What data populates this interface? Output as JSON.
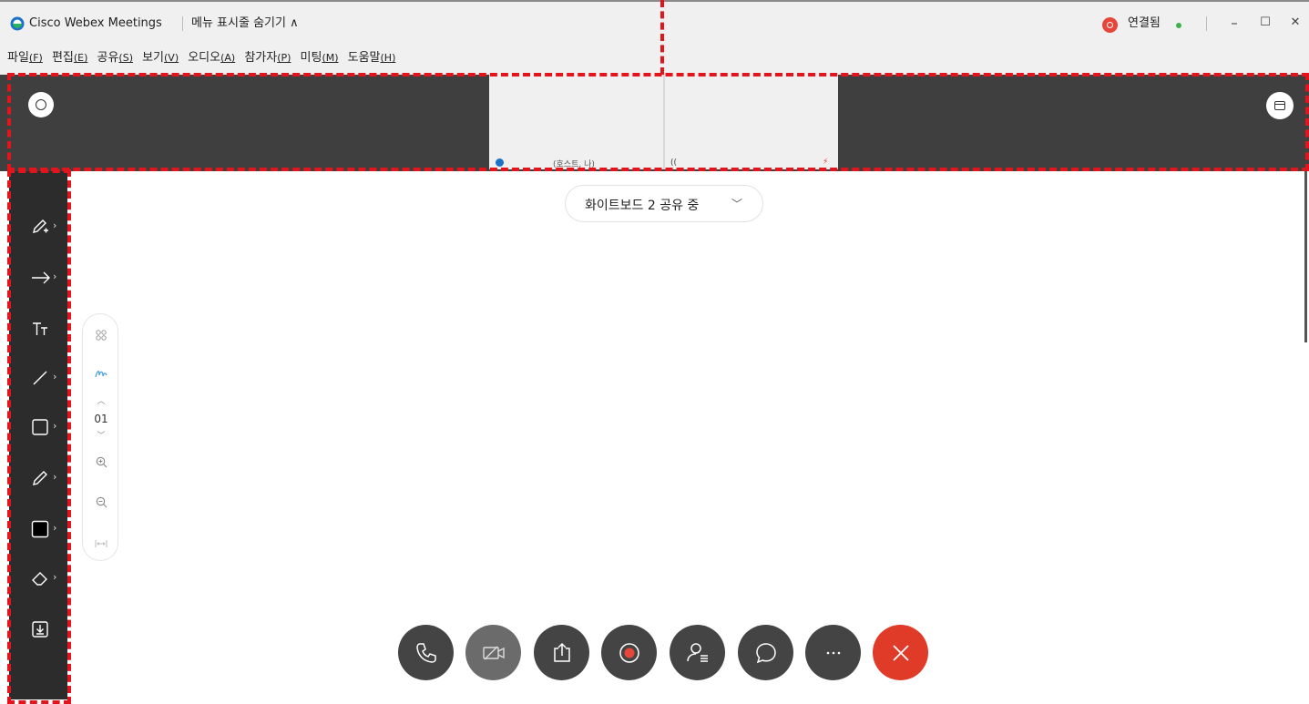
{
  "window": {
    "app_title": "Cisco Webex Meetings",
    "menu_toggle": "메뉴 표시줄 숨기기 ∧",
    "status_text": "연결됨",
    "min_glyph": "–",
    "max_glyph": "☐",
    "close_glyph": "✕"
  },
  "menu": [
    {
      "label": "파일",
      "key": "(F)"
    },
    {
      "label": "편집",
      "key": "(E)"
    },
    {
      "label": "공유",
      "key": "(S)"
    },
    {
      "label": "보기",
      "key": "(V)"
    },
    {
      "label": "오디오",
      "key": "(A)"
    },
    {
      "label": "참가자",
      "key": "(P)"
    },
    {
      "label": "미팅",
      "key": "(M)"
    },
    {
      "label": "도움말",
      "key": "(H)"
    }
  ],
  "video": {
    "host_label": "(호스트, 나)"
  },
  "share": {
    "label": "화이트보드 2 공유 중"
  },
  "zoom": {
    "page_number": "01"
  },
  "colors": {
    "accent_red": "#e4141c",
    "end_call": "#e03a28",
    "toolbar_bg": "#2c2c2c",
    "video_strip_bg": "#3f3f3f",
    "connected_green": "#3db24b"
  },
  "icons": {
    "toolbar": [
      "pen-plus-icon",
      "arrow-icon",
      "text-icon",
      "line-icon",
      "rectangle-icon",
      "pencil-icon",
      "color-swatch-icon",
      "eraser-icon",
      "save-icon"
    ],
    "controls": [
      "phone-icon",
      "video-off-icon",
      "share-icon",
      "record-icon",
      "participants-icon",
      "chat-icon",
      "more-icon",
      "end-call-icon"
    ]
  }
}
